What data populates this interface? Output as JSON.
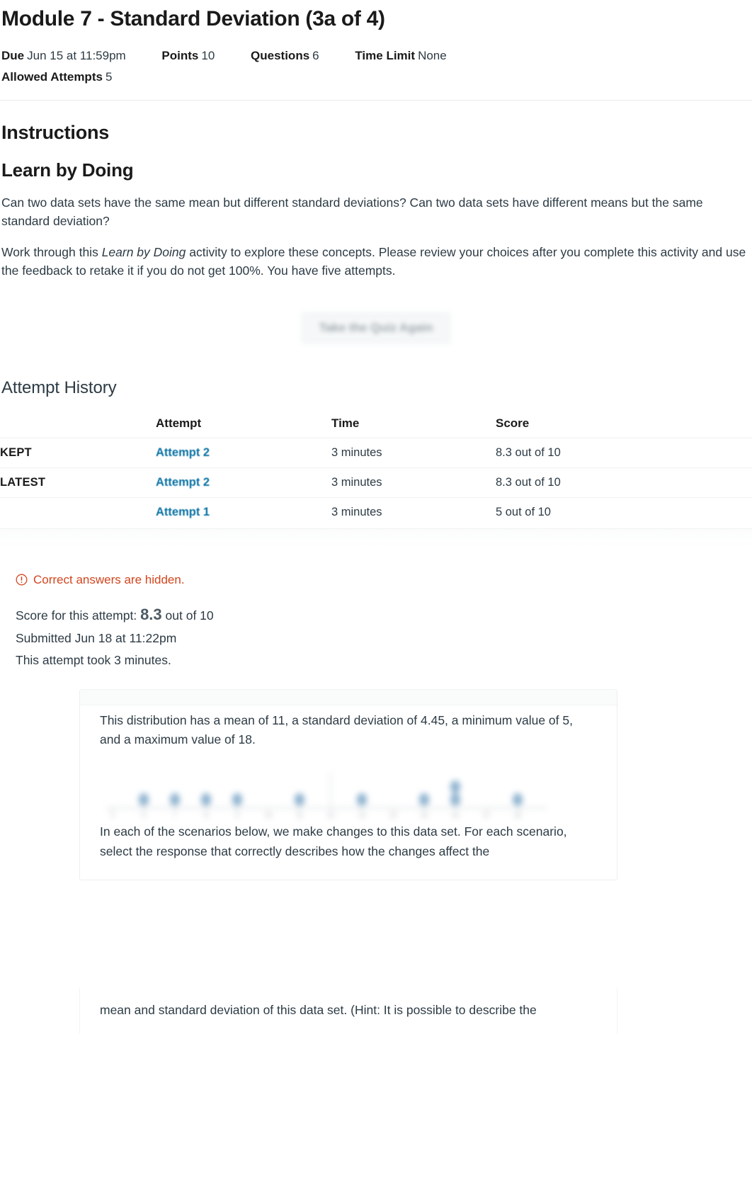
{
  "quiz": {
    "title": "Module 7 - Standard Deviation (3a of 4)",
    "meta": [
      {
        "label": "Due",
        "value": "Jun 15 at 11:59pm"
      },
      {
        "label": "Points",
        "value": "10"
      },
      {
        "label": "Questions",
        "value": "6"
      },
      {
        "label": "Time Limit",
        "value": "None"
      }
    ],
    "allowed_attempts": {
      "label": "Allowed Attempts",
      "value": "5"
    }
  },
  "instructions": {
    "heading": "Instructions",
    "subheading": "Learn by Doing",
    "paragraph1": "Can two data sets have the same mean but different standard deviations? Can two data sets have different means but the same standard deviation?",
    "paragraph2_part1": "Work through this ",
    "paragraph2_emphasis": "Learn by Doing",
    "paragraph2_part2": " activity to explore these concepts. Please review your choices after you complete this activity and use the feedback to retake it if you do not get 100%. You have five attempts."
  },
  "actions": {
    "take_quiz_again": "Take the Quiz Again"
  },
  "attempt_history": {
    "heading": "Attempt History",
    "columns": [
      "",
      "Attempt",
      "Time",
      "Score"
    ],
    "rows": [
      {
        "flag": "KEPT",
        "attempt": "Attempt 2",
        "time": "3 minutes",
        "score": "8.3 out of 10"
      },
      {
        "flag": "LATEST",
        "attempt": "Attempt 2",
        "time": "3 minutes",
        "score": "8.3 out of 10"
      },
      {
        "flag": "",
        "attempt": "Attempt 1",
        "time": "3 minutes",
        "score": "5 out of 10"
      }
    ]
  },
  "notice": {
    "icon": "warning-circle-icon",
    "text": "Correct answers are hidden.",
    "color": "#D2451E"
  },
  "result": {
    "score_prefix": "Score for this attempt:",
    "score_value": "8.3",
    "score_suffix": "out of 10",
    "submitted": "Submitted Jun 18 at 11:22pm",
    "duration": "This attempt took 3 minutes."
  },
  "question": {
    "distribution_text": "This distribution has a mean of 11, a standard deviation of 4.45, a minimum value of 5, and a maximum value of 18.",
    "scenario_text": "In each of the scenarios below, we make changes to this data set. For each scenario, select the response that correctly describes how the changes affect the",
    "continuation_text": "mean and standard deviation of this data set. (Hint: It is possible to describe the"
  },
  "chart_data": {
    "type": "dotplot",
    "title": "",
    "xlabel": "",
    "ylabel": "",
    "dot_color": "#7FA8C9",
    "axis_color": "#b9bfc4",
    "x": [
      5,
      6,
      7,
      8,
      9,
      10,
      11,
      12,
      13,
      14,
      15,
      16,
      17,
      18
    ],
    "counts": [
      0,
      1,
      1,
      1,
      1,
      0,
      1,
      0,
      1,
      0,
      1,
      2,
      0,
      1
    ],
    "xlim": [
      4.5,
      18.5
    ],
    "ylim": [
      0,
      3
    ],
    "grid": false,
    "legend": "none"
  }
}
